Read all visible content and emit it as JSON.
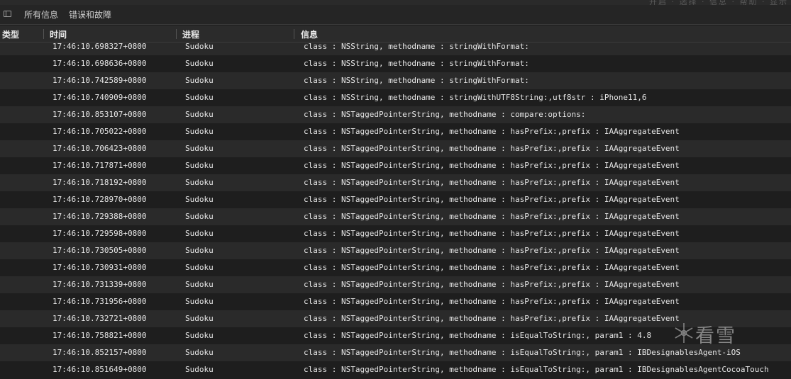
{
  "top_strip": {
    "ghost_text": "开启  ·  选择  ·  信息  ·  帮助  ·  显示"
  },
  "toolbar": {
    "filters": [
      "所有信息",
      "错误和故障"
    ]
  },
  "columns": [
    "类型",
    "时间",
    "进程",
    "信息"
  ],
  "rows": [
    {
      "time": "17:46:10.698327+0800",
      "process": "Sudoku",
      "message": "class : NSString, methodname : stringWithFormat:"
    },
    {
      "time": "17:46:10.698636+0800",
      "process": "Sudoku",
      "message": "class : NSString, methodname : stringWithFormat:"
    },
    {
      "time": "17:46:10.742589+0800",
      "process": "Sudoku",
      "message": "class : NSString, methodname : stringWithFormat:"
    },
    {
      "time": "17:46:10.740909+0800",
      "process": "Sudoku",
      "message": "class : NSString, methodname : stringWithUTF8String:,utf8str : iPhone11,6"
    },
    {
      "time": "17:46:10.853107+0800",
      "process": "Sudoku",
      "message": "class : NSTaggedPointerString, methodname : compare:options:"
    },
    {
      "time": "17:46:10.705022+0800",
      "process": "Sudoku",
      "message": "class : NSTaggedPointerString, methodname : hasPrefix:,prefix : IAAggregateEvent"
    },
    {
      "time": "17:46:10.706423+0800",
      "process": "Sudoku",
      "message": "class : NSTaggedPointerString, methodname : hasPrefix:,prefix : IAAggregateEvent"
    },
    {
      "time": "17:46:10.717871+0800",
      "process": "Sudoku",
      "message": "class : NSTaggedPointerString, methodname : hasPrefix:,prefix : IAAggregateEvent"
    },
    {
      "time": "17:46:10.718192+0800",
      "process": "Sudoku",
      "message": "class : NSTaggedPointerString, methodname : hasPrefix:,prefix : IAAggregateEvent"
    },
    {
      "time": "17:46:10.728970+0800",
      "process": "Sudoku",
      "message": "class : NSTaggedPointerString, methodname : hasPrefix:,prefix : IAAggregateEvent"
    },
    {
      "time": "17:46:10.729388+0800",
      "process": "Sudoku",
      "message": "class : NSTaggedPointerString, methodname : hasPrefix:,prefix : IAAggregateEvent"
    },
    {
      "time": "17:46:10.729598+0800",
      "process": "Sudoku",
      "message": "class : NSTaggedPointerString, methodname : hasPrefix:,prefix : IAAggregateEvent"
    },
    {
      "time": "17:46:10.730505+0800",
      "process": "Sudoku",
      "message": "class : NSTaggedPointerString, methodname : hasPrefix:,prefix : IAAggregateEvent"
    },
    {
      "time": "17:46:10.730931+0800",
      "process": "Sudoku",
      "message": "class : NSTaggedPointerString, methodname : hasPrefix:,prefix : IAAggregateEvent"
    },
    {
      "time": "17:46:10.731339+0800",
      "process": "Sudoku",
      "message": "class : NSTaggedPointerString, methodname : hasPrefix:,prefix : IAAggregateEvent"
    },
    {
      "time": "17:46:10.731956+0800",
      "process": "Sudoku",
      "message": "class : NSTaggedPointerString, methodname : hasPrefix:,prefix : IAAggregateEvent"
    },
    {
      "time": "17:46:10.732721+0800",
      "process": "Sudoku",
      "message": "class : NSTaggedPointerString, methodname : hasPrefix:,prefix : IAAggregateEvent"
    },
    {
      "time": "17:46:10.758821+0800",
      "process": "Sudoku",
      "message": "class : NSTaggedPointerString, methodname : isEqualToString:, param1 : 4.8"
    },
    {
      "time": "17:46:10.852157+0800",
      "process": "Sudoku",
      "message": "class : NSTaggedPointerString, methodname : isEqualToString:, param1 : IBDesignablesAgent-iOS"
    },
    {
      "time": "17:46:10.851649+0800",
      "process": "Sudoku",
      "message": "class : NSTaggedPointerString, methodname : isEqualToString:, param1 : IBDesignablesAgentCocoaTouch"
    }
  ],
  "watermark": {
    "text": "看雪",
    "icon": "snowflake-logo-icon"
  }
}
